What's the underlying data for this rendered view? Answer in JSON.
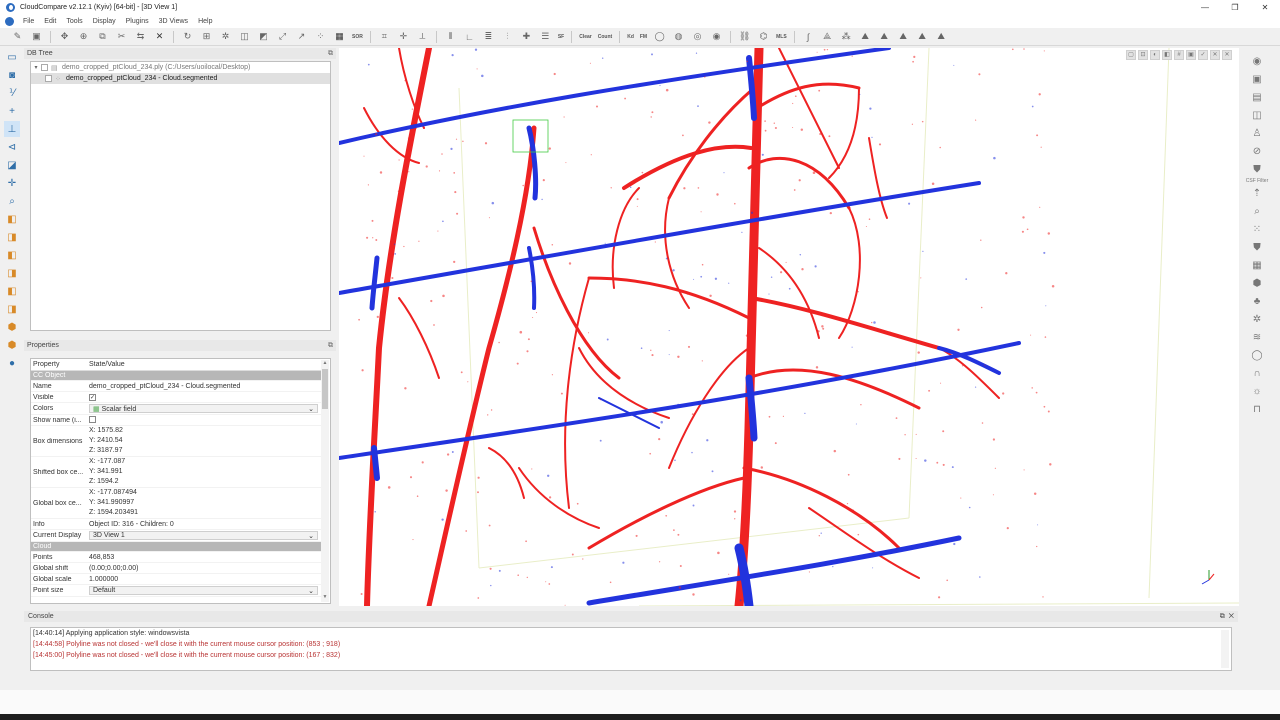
{
  "window": {
    "title": "CloudCompare v2.12.1 (Kyiv) [64-bit] - [3D View 1]",
    "minimize": "—",
    "maximize": "❐",
    "close": "✕"
  },
  "menu": {
    "items": [
      "File",
      "Edit",
      "Tools",
      "Display",
      "Plugins",
      "3D Views",
      "Help"
    ]
  },
  "toolbar": {
    "sor_label": "SOR",
    "sf_label": "SF",
    "clear_label": "Clear",
    "count_label": "Count",
    "kd_label": "Kd",
    "fm_label": "FM",
    "mls_label": "MLS"
  },
  "db_tree": {
    "title": "DB Tree",
    "items": [
      {
        "label": "demo_cropped_ptCloud_234.ply (C:/Users/uoilocal/Desktop)"
      },
      {
        "label": "demo_cropped_ptCloud_234 - Cloud.segmented"
      }
    ]
  },
  "properties": {
    "title": "Properties",
    "col_property": "Property",
    "col_state": "State/Value",
    "group_object": "CC Object",
    "name_label": "Name",
    "name_value": "demo_cropped_ptCloud_234 - Cloud.segmented",
    "visible_label": "Visible",
    "colors_label": "Colors",
    "colors_value": "Scalar field",
    "show_name_label": "Show name (i...",
    "box_dim_label": "Box dimensions",
    "box_dim": [
      "X: 1575.82",
      "Y: 2410.54",
      "Z: 3187.97"
    ],
    "shifted_label": "Shifted box ce...",
    "shifted": [
      "X: -177.087",
      "Y: 341.991",
      "Z: 1594.2"
    ],
    "global_box_label": "Global box ce...",
    "global_box": [
      "X: -177.087494",
      "Y: 341.990997",
      "Z: 1594.203491"
    ],
    "info_label": "Info",
    "info_value": "Object ID: 316 - Children: 0",
    "current_display_label": "Current Display",
    "current_display_value": "3D View 1",
    "group_cloud": "Cloud",
    "points_label": "Points",
    "points_value": "468,853",
    "global_shift_label": "Global shift",
    "global_shift_value": "(0.00;0.00;0.00)",
    "global_scale_label": "Global scale",
    "global_scale_value": "1.000000",
    "point_size_label": "Point size",
    "point_size_value": "Default"
  },
  "console": {
    "title": "Console",
    "lines": [
      {
        "text": "[14:40:14] Applying application style: windowsvista",
        "level": "info"
      },
      {
        "text": "[14:44:58] Polyline was not closed - we'll close it with the current mouse cursor position: (853 ; 918)",
        "level": "warn"
      },
      {
        "text": "[14:45:00] Polyline was not closed - we'll close it with the current mouse cursor position: (167 ; 832)",
        "level": "warn"
      }
    ]
  },
  "right_toolbar": {
    "csf_label": "CSF Filter"
  },
  "colors": {
    "segment_red": "#ee2222",
    "segment_blue": "#2233dd",
    "accent": "#2f6ea8"
  }
}
